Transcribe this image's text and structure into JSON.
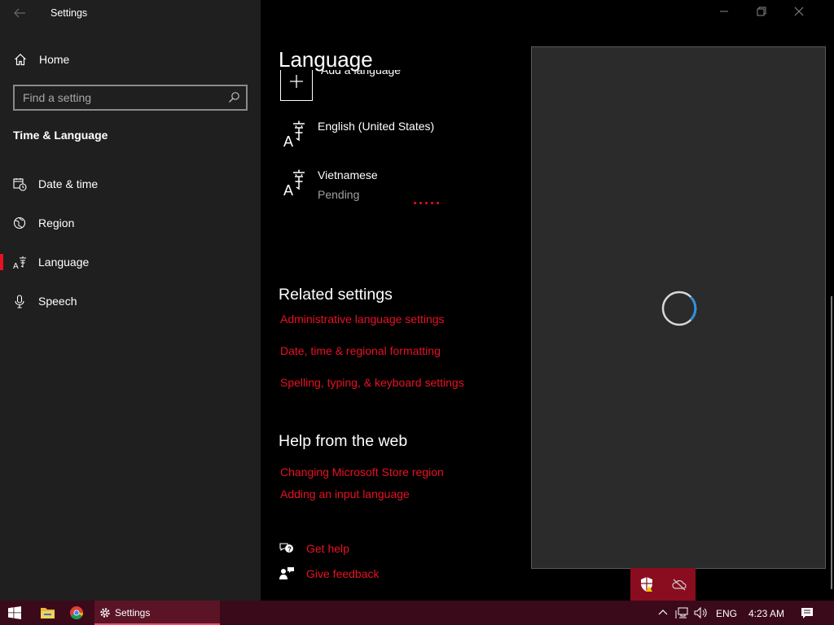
{
  "app": {
    "title": "Settings"
  },
  "sidebar": {
    "home_label": "Home",
    "search": {
      "placeholder": "Find a setting"
    },
    "section_title": "Time & Language",
    "items": [
      {
        "label": "Date & time",
        "icon": "calendar-clock-icon"
      },
      {
        "label": "Region",
        "icon": "globe-icon"
      },
      {
        "label": "Language",
        "icon": "language-icon",
        "selected": true
      },
      {
        "label": "Speech",
        "icon": "microphone-icon"
      }
    ]
  },
  "main": {
    "page_title": "Language",
    "add_language_label": "Add a language",
    "languages": [
      {
        "name": "English (United States)",
        "status": ""
      },
      {
        "name": "Vietnamese",
        "status": "Pending"
      }
    ],
    "related_title": "Related settings",
    "related_links": [
      "Administrative language settings",
      "Date, time & regional formatting",
      "Spelling, typing, & keyboard settings"
    ],
    "help_title": "Help from the web",
    "help_links": [
      "Changing Microsoft Store region",
      "Adding an input language"
    ],
    "get_help": "Get help",
    "give_feedback": "Give feedback"
  },
  "taskbar": {
    "settings_label": "Settings",
    "input_language": "ENG",
    "clock": "4:23 AM"
  },
  "colors": {
    "accent": "#e81123",
    "sidebar_bg": "#1f1f1f",
    "taskbar_bg": "#3b0a1a",
    "overlay_bg": "#2b2b2b",
    "spinner": "#2f8fdb"
  }
}
